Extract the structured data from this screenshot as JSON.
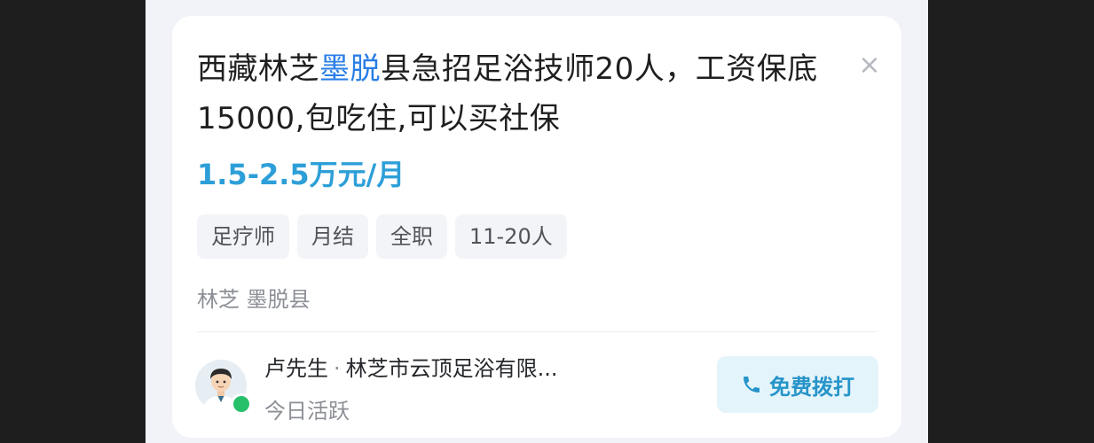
{
  "job": {
    "title_part1": "西藏林芝",
    "title_highlight": "墨脱",
    "title_part2": "县急招足浴技师20人，工资保底15000,包吃住,可以买社保",
    "salary": "1.5-2.5万元/月",
    "tags": [
      "足疗师",
      "月结",
      "全职",
      "11-20人"
    ],
    "location": "林芝 墨脱县"
  },
  "contact": {
    "name": "卢先生",
    "separator": "·",
    "company": "林芝市云顶足浴有限...",
    "status": "今日活跃"
  },
  "actions": {
    "close_glyph": "×",
    "call_label": "免费拨打"
  },
  "colors": {
    "highlight": "#2a7ee6",
    "salary": "#2d9fd8",
    "call_bg": "#e4f4fb",
    "online": "#27c06a"
  }
}
